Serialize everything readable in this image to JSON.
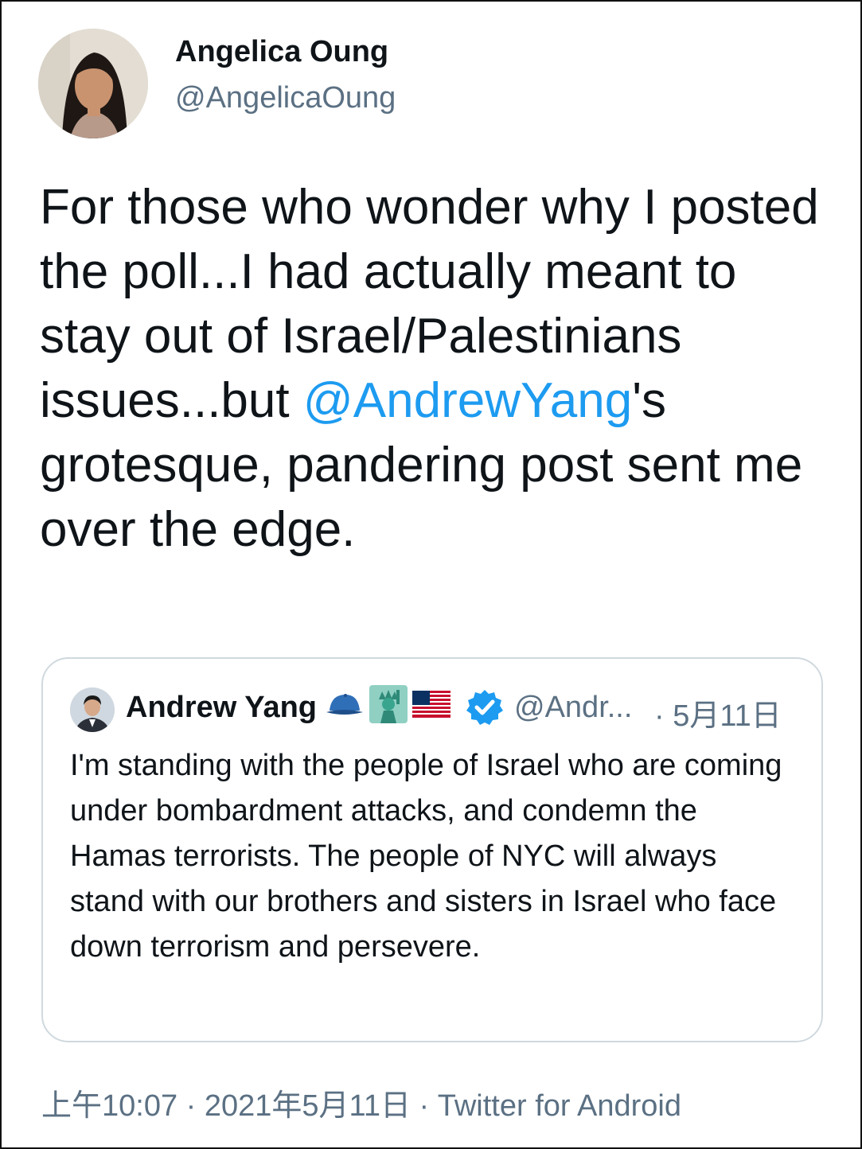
{
  "tweet": {
    "author_name": "Angelica Oung",
    "author_handle": "@AngelicaOung",
    "text_part1": "For those who wonder why I posted the poll...I had actually meant to stay out of Israel/Palestinians issues...but ",
    "mention": "@AndrewYang",
    "text_part2": "'s grotesque, pandering post sent me over the edge.",
    "timestamp": "上午10:07 · 2021年5月11日 · Twitter for Android"
  },
  "quoted_tweet": {
    "author_name": "Andrew Yang",
    "author_emojis": [
      "blue-cap-icon",
      "statue-of-liberty-icon",
      "us-flag-icon"
    ],
    "verified": true,
    "author_handle": "@Andr...",
    "date": "· 5月11日",
    "text": "I'm standing with the people of Israel who are coming under bombardment attacks, and condemn the Hamas terrorists. The people of NYC will always stand with our brothers and sisters in Israel who face down terrorism and persevere."
  },
  "colors": {
    "text": "#0f1419",
    "secondary": "#5b7083",
    "link": "#1d9bf0",
    "border": "#cfd9de"
  }
}
